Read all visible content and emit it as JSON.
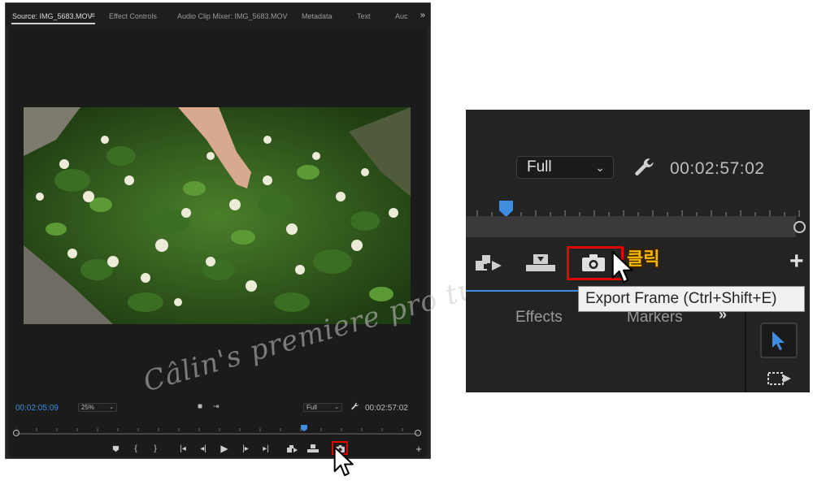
{
  "source_monitor": {
    "tabs": [
      "Source: IMG_5683.MOV",
      "Effect Controls",
      "Audio Clip Mixer: IMG_5683.MOV",
      "Metadata",
      "Text",
      "Auc"
    ],
    "current_timecode": "00:02:05:09",
    "zoom": "25%",
    "quality": "Full",
    "duration": "00:02:57:02",
    "watermark": "Câlin's premiere pro tutorials"
  },
  "zoomed_view": {
    "quality": "Full",
    "duration": "00:02:57:02",
    "click_label": "클릭",
    "tooltip": "Export Frame (Ctrl+Shift+E)",
    "panel_tabs": [
      "Effects",
      "Markers"
    ]
  },
  "colors": {
    "accent_blue": "#3f8de0",
    "highlight_red": "#e00000",
    "click_label_yellow": "#f5b800"
  }
}
